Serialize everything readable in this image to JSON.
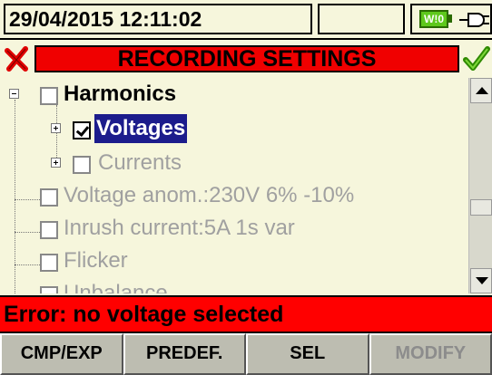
{
  "status": {
    "datetime": "29/04/2015 12:11:02",
    "battery_label": "W!0"
  },
  "header": {
    "title": "RECORDING SETTINGS",
    "cancel_icon": "red-x-icon",
    "confirm_icon": "green-check-icon"
  },
  "tree": {
    "items": [
      {
        "label": "Harmonics",
        "checked": false,
        "enabled": true
      },
      {
        "label": "Voltages",
        "checked": true,
        "enabled": true,
        "selected": true
      },
      {
        "label": "Currents",
        "checked": false,
        "enabled": false
      },
      {
        "label": "Voltage anom.:230V 6% -10%",
        "checked": false,
        "enabled": false
      },
      {
        "label": "Inrush current:5A 1s var",
        "checked": false,
        "enabled": false
      },
      {
        "label": "Flicker",
        "checked": false,
        "enabled": false
      },
      {
        "label": "Unbalance",
        "checked": false,
        "enabled": false
      }
    ]
  },
  "error": {
    "message": "Error: no voltage selected"
  },
  "softkeys": [
    {
      "label": "CMP/EXP",
      "enabled": true
    },
    {
      "label": "PREDEF.",
      "enabled": true
    },
    {
      "label": "SEL",
      "enabled": true
    },
    {
      "label": "MODIFY",
      "enabled": false
    }
  ],
  "colors": {
    "accent_red": "#ff0000",
    "selection": "#1c1c8c",
    "background": "#f6f6dc"
  }
}
